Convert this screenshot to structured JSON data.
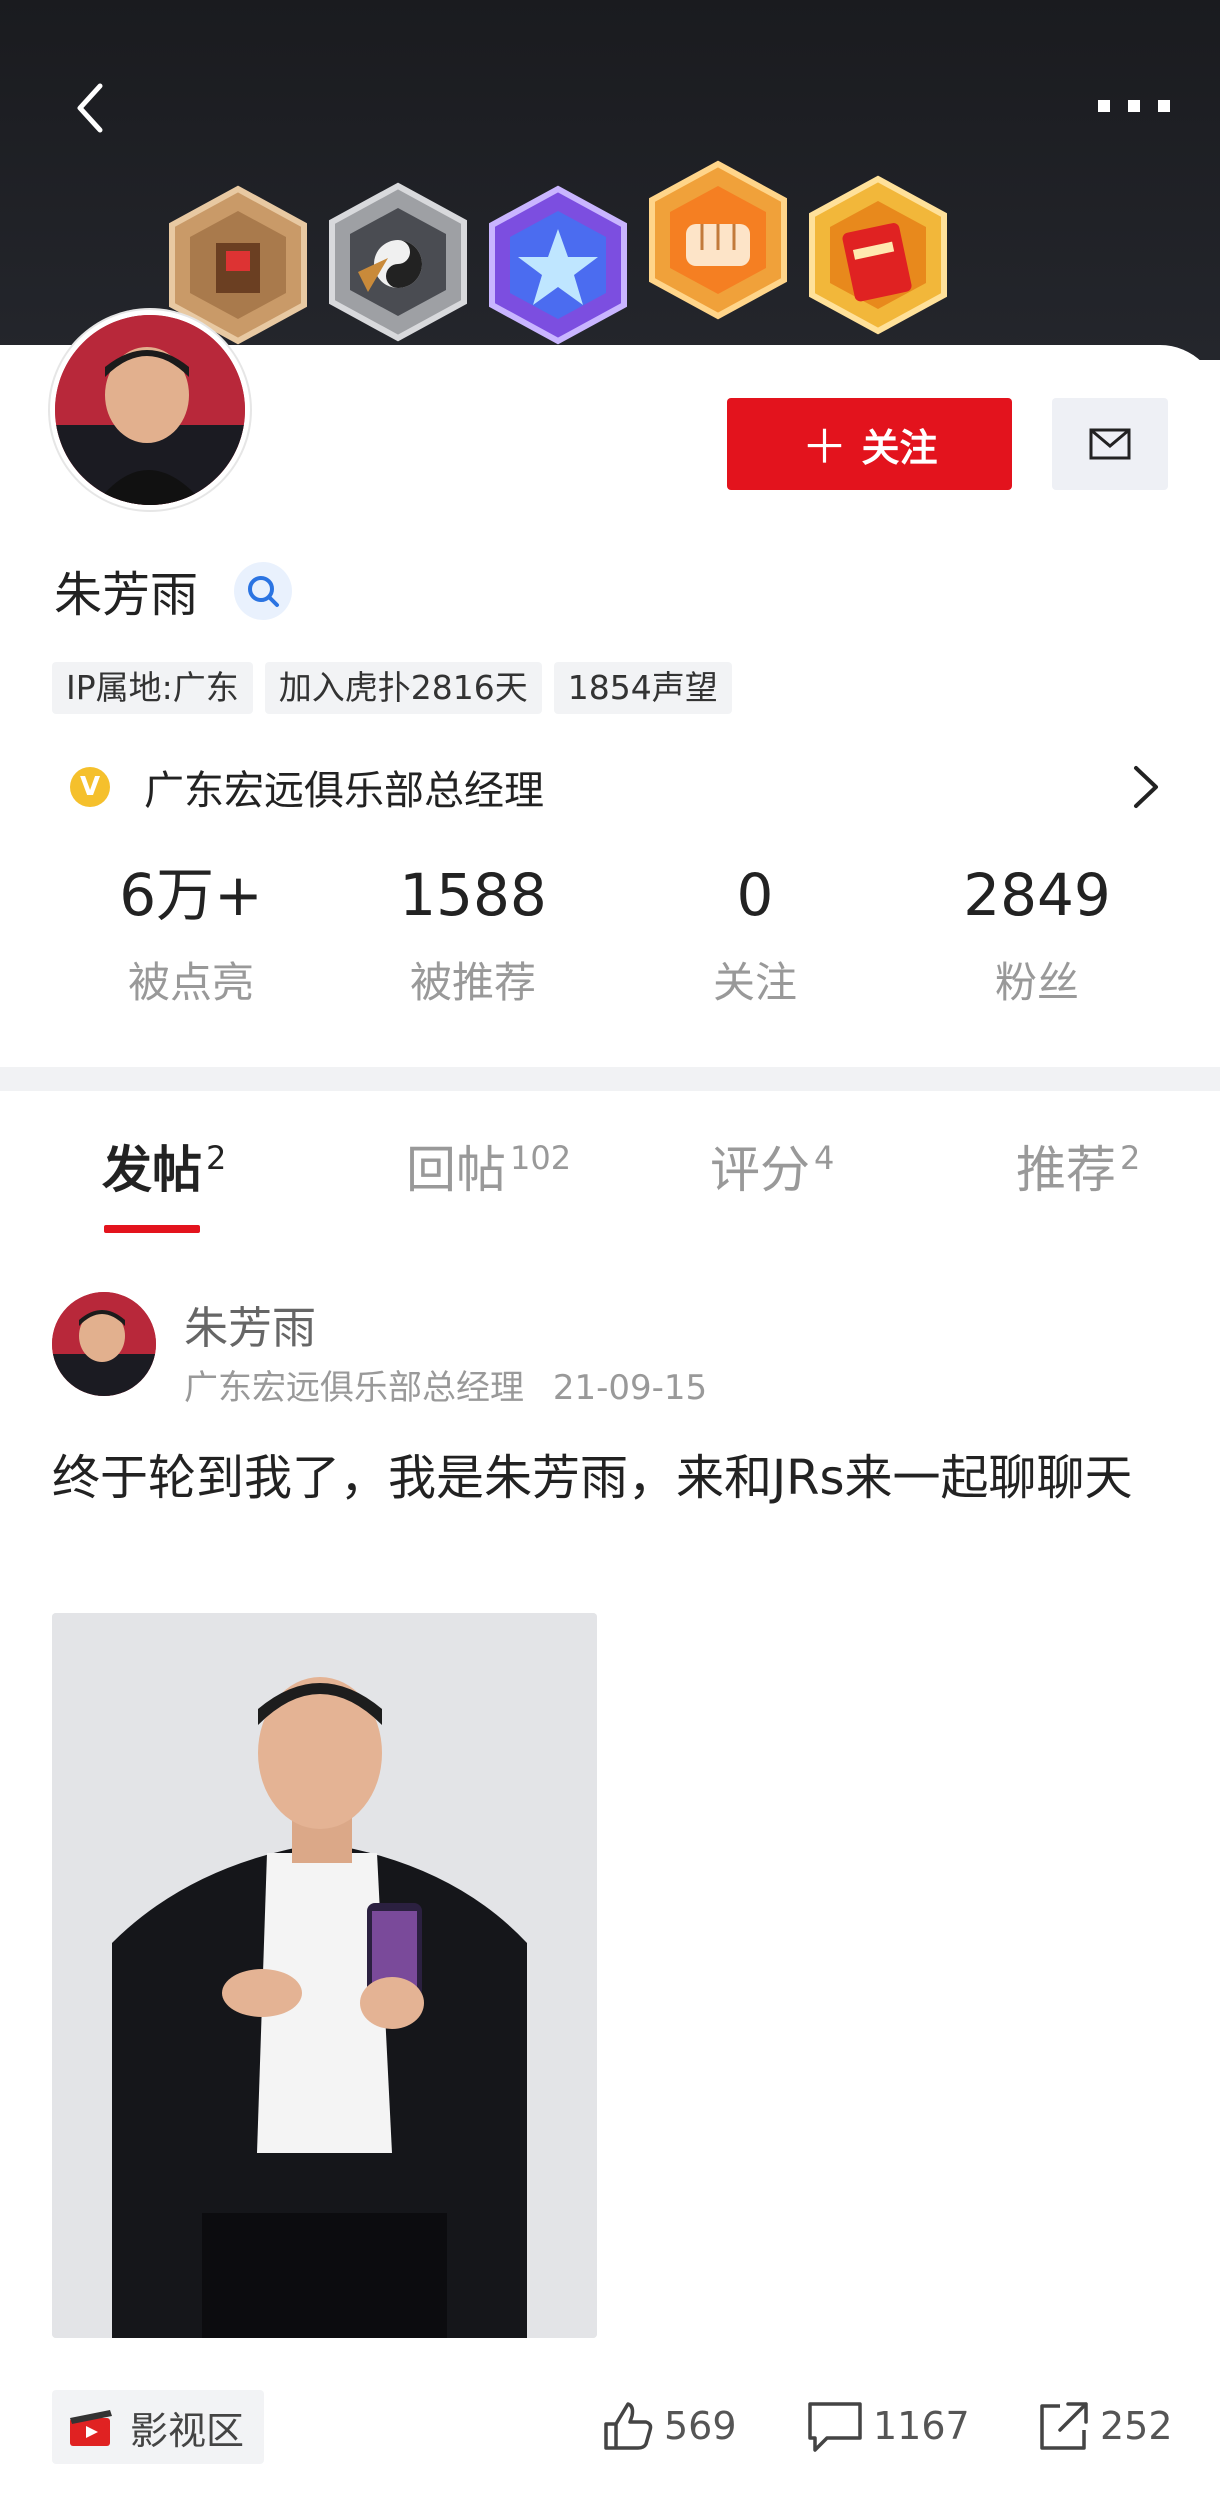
{
  "header": {
    "back_icon": "chevron-left-icon",
    "more_icon": "more-dots-icon",
    "badges": [
      "badge-1",
      "badge-2",
      "badge-3",
      "badge-4",
      "badge-5"
    ]
  },
  "profile": {
    "name": "朱芳雨",
    "follow_label": "关注",
    "tags": [
      "IP属地:广东",
      "加入虎扑2816天",
      "1854声望"
    ],
    "certification": "广东宏远俱乐部总经理",
    "cert_badge": "V"
  },
  "stats": [
    {
      "value": "6万+",
      "label": "被点亮"
    },
    {
      "value": "1588",
      "label": "被推荐"
    },
    {
      "value": "0",
      "label": "关注"
    },
    {
      "value": "2849",
      "label": "粉丝"
    }
  ],
  "tabs": [
    {
      "label": "发帖",
      "count": "2"
    },
    {
      "label": "回帖",
      "count": "102"
    },
    {
      "label": "评分",
      "count": "4"
    },
    {
      "label": "推荐",
      "count": "2"
    }
  ],
  "post": {
    "author": "朱芳雨",
    "title": "广东宏远俱乐部总经理",
    "date": "21-09-15",
    "text": "终于轮到我了，我是朱芳雨，来和JRs来一起聊聊天",
    "category": "影视区",
    "likes": "569",
    "comments": "1167",
    "shares": "252"
  },
  "colors": {
    "accent": "#e3131d",
    "header_bg": "#1a1b1f",
    "muted": "#999999"
  }
}
